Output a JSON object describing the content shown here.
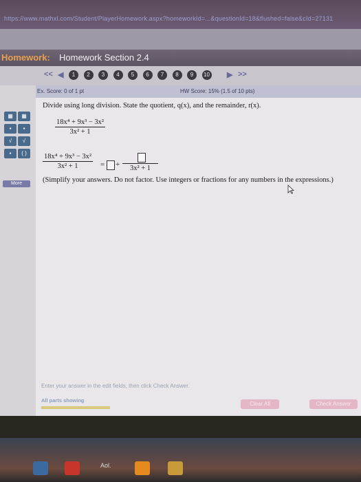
{
  "browser": {
    "url_text": "https://www.mathxl.com/Student/PlayerHomework.aspx?homeworkId=...&questionId=18&flushed=false&cId=27131"
  },
  "header": {
    "label": "Homework:",
    "section": "Homework Section 2.4"
  },
  "nav": {
    "prev": "<<",
    "next": ">>",
    "question_numbers": [
      "1",
      "2",
      "3",
      "4",
      "5",
      "6",
      "7",
      "8",
      "9",
      "10"
    ]
  },
  "score": {
    "ex_score": "Ex. Score: 0 of 1 pt",
    "hw_score": "HW Score: 15% (1.5 of 10 pts)"
  },
  "question": {
    "prompt": "Divide using long division. State the quotient, q(x), and the remainder, r(x).",
    "numerator": "18x⁴ + 9x³ − 3x²",
    "denominator": "3x² + 1",
    "answer_equals": "=",
    "answer_plus": "+",
    "instructions": "(Simplify your answers. Do not factor. Use integers or fractions for any numbers in the expressions.)"
  },
  "sidebar": {
    "more_label": "More"
  },
  "footer": {
    "hint": "Enter your answer in the edit fields, then click Check Answer.",
    "parts_showing": "All parts showing",
    "clear_all": "Clear All",
    "check_answer": "Check Answer"
  },
  "taskbar": {
    "aol_label": "Aol."
  }
}
